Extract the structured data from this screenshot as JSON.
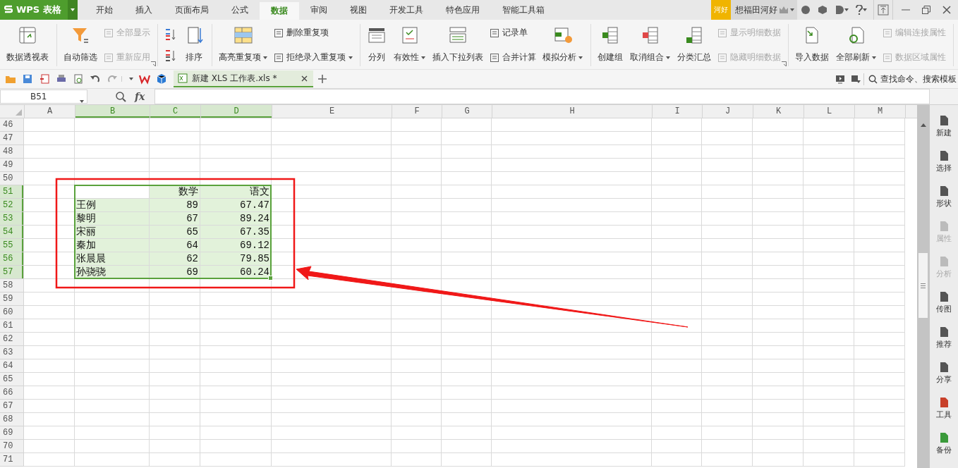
{
  "app_menu": {
    "label": "WPS 表格"
  },
  "ribbon_tabs": [
    {
      "label": "开始",
      "selected": false
    },
    {
      "label": "插入",
      "selected": false
    },
    {
      "label": "页面布局",
      "selected": false
    },
    {
      "label": "公式",
      "selected": false
    },
    {
      "label": "数据",
      "selected": true
    },
    {
      "label": "审阅",
      "selected": false
    },
    {
      "label": "视图",
      "selected": false
    },
    {
      "label": "开发工具",
      "selected": false
    },
    {
      "label": "特色应用",
      "selected": false
    },
    {
      "label": "智能工具箱",
      "selected": false
    }
  ],
  "account": {
    "badge": "河好",
    "name": "想福田河好"
  },
  "ribbon": [
    {
      "items": [
        {
          "kind": "large",
          "label": "数据透视表"
        }
      ]
    },
    {
      "launcher": true,
      "items": [
        {
          "kind": "large",
          "label": "自动筛选"
        },
        {
          "kind": "stack",
          "buttons": [
            {
              "label": "全部显示",
              "disabled": true
            },
            {
              "label": "重新应用",
              "disabled": true
            }
          ]
        }
      ]
    },
    {
      "items": [
        {
          "kind": "sort"
        },
        {
          "kind": "large",
          "label": "排序"
        }
      ]
    },
    {
      "items": [
        {
          "kind": "large",
          "label": "高亮重复项",
          "dropdown": true
        },
        {
          "kind": "stack",
          "buttons": [
            {
              "label": "删除重复项",
              "disabled": false
            },
            {
              "label": "拒绝录入重复项",
              "disabled": false,
              "dropdown": true
            }
          ]
        }
      ]
    },
    {
      "items": [
        {
          "kind": "large",
          "label": "分列"
        },
        {
          "kind": "large",
          "label": "有效性",
          "dropdown": true
        },
        {
          "kind": "large",
          "label": "插入下拉列表"
        },
        {
          "kind": "stack",
          "buttons": [
            {
              "label": "记录单",
              "disabled": false
            },
            {
              "label": "合并计算",
              "disabled": false
            }
          ]
        },
        {
          "kind": "large",
          "label": "模拟分析",
          "dropdown": true
        }
      ]
    },
    {
      "launcher": true,
      "items": [
        {
          "kind": "large",
          "label": "创建组"
        },
        {
          "kind": "large",
          "label": "取消组合",
          "dropdown": true
        },
        {
          "kind": "large",
          "label": "分类汇总"
        },
        {
          "kind": "stack",
          "buttons": [
            {
              "label": "显示明细数据",
              "disabled": true
            },
            {
              "label": "隐藏明细数据",
              "disabled": true
            }
          ]
        }
      ]
    },
    {
      "items": [
        {
          "kind": "large",
          "label": "导入数据"
        },
        {
          "kind": "large",
          "label": "全部刷新",
          "dropdown": true
        },
        {
          "kind": "stack",
          "buttons": [
            {
              "label": "编辑连接属性",
              "disabled": true
            },
            {
              "label": "数据区域属性",
              "disabled": true
            }
          ]
        }
      ]
    }
  ],
  "document_tab": {
    "title": "新建 XLS 工作表.xls *",
    "selected": true
  },
  "search": {
    "placeholder": "查找命令、搜索模板"
  },
  "formula_bar": {
    "name_box": "B51",
    "function_label": "fx"
  },
  "sheet": {
    "columns": [
      {
        "label": "A",
        "selected": false
      },
      {
        "label": "B",
        "selected": true
      },
      {
        "label": "C",
        "selected": true
      },
      {
        "label": "D",
        "selected": true
      },
      {
        "label": "E",
        "selected": false
      },
      {
        "label": "F",
        "selected": false
      },
      {
        "label": "G",
        "selected": false
      },
      {
        "label": "H",
        "selected": false
      },
      {
        "label": "I",
        "selected": false
      },
      {
        "label": "J",
        "selected": false
      },
      {
        "label": "K",
        "selected": false
      },
      {
        "label": "L",
        "selected": false
      },
      {
        "label": "M",
        "selected": false
      }
    ],
    "rows": [
      {
        "label": "46",
        "selected": false
      },
      {
        "label": "47",
        "selected": false
      },
      {
        "label": "48",
        "selected": false
      },
      {
        "label": "49",
        "selected": false
      },
      {
        "label": "50",
        "selected": false
      },
      {
        "label": "51",
        "selected": true
      },
      {
        "label": "52",
        "selected": true
      },
      {
        "label": "53",
        "selected": true
      },
      {
        "label": "54",
        "selected": true
      },
      {
        "label": "55",
        "selected": true
      },
      {
        "label": "56",
        "selected": true
      },
      {
        "label": "57",
        "selected": true
      },
      {
        "label": "58",
        "selected": false
      },
      {
        "label": "59",
        "selected": false
      },
      {
        "label": "60",
        "selected": false
      },
      {
        "label": "61",
        "selected": false
      },
      {
        "label": "62",
        "selected": false
      },
      {
        "label": "63",
        "selected": false
      },
      {
        "label": "64",
        "selected": false
      },
      {
        "label": "65",
        "selected": false
      },
      {
        "label": "66",
        "selected": false
      },
      {
        "label": "67",
        "selected": false
      },
      {
        "label": "68",
        "selected": false
      },
      {
        "label": "69",
        "selected": false
      },
      {
        "label": "70",
        "selected": false
      },
      {
        "label": "71",
        "selected": false
      }
    ],
    "data_table": {
      "header": [
        "数学",
        "语文"
      ],
      "rows": [
        [
          "王例",
          "89",
          "67.47"
        ],
        [
          "黎明",
          "67",
          "89.24"
        ],
        [
          "宋丽",
          "65",
          "67.35"
        ],
        [
          "秦加",
          "64",
          "69.12"
        ],
        [
          "张晨晨",
          "62",
          "79.85"
        ],
        [
          "孙骁骁",
          "69",
          "60.24"
        ]
      ]
    }
  },
  "side_panel": [
    {
      "label": "新建",
      "disabled": false
    },
    {
      "label": "选择",
      "disabled": false
    },
    {
      "label": "形状",
      "disabled": false
    },
    {
      "label": "属性",
      "disabled": true
    },
    {
      "label": "分析",
      "disabled": true
    },
    {
      "label": "传图",
      "disabled": false
    },
    {
      "label": "推荐",
      "disabled": false
    },
    {
      "label": "分享",
      "disabled": false
    },
    {
      "label": "工具",
      "disabled": false
    },
    {
      "label": "备份",
      "disabled": false
    }
  ]
}
